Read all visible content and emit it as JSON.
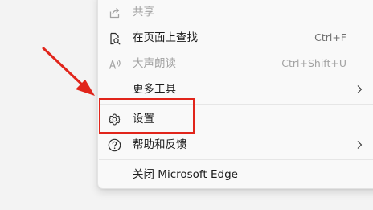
{
  "menu": {
    "items": [
      {
        "label": "共享",
        "shortcut": "",
        "icon": "share-icon",
        "disabled": true,
        "submenu": false
      },
      {
        "label": "在页面上查找",
        "shortcut": "Ctrl+F",
        "icon": "find-on-page-icon",
        "disabled": false,
        "submenu": false
      },
      {
        "label": "大声朗读",
        "shortcut": "Ctrl+Shift+U",
        "icon": "read-aloud-icon",
        "disabled": true,
        "submenu": false
      },
      {
        "label": "更多工具",
        "shortcut": "",
        "icon": "",
        "disabled": false,
        "submenu": true
      },
      {
        "label": "设置",
        "shortcut": "",
        "icon": "gear-icon",
        "disabled": false,
        "submenu": false
      },
      {
        "label": "帮助和反馈",
        "shortcut": "",
        "icon": "help-icon",
        "disabled": false,
        "submenu": true
      },
      {
        "label": "关闭 Microsoft Edge",
        "shortcut": "",
        "icon": "",
        "disabled": false,
        "submenu": false
      }
    ]
  },
  "annotation": {
    "highlight_color": "#e1251b",
    "arrow_color": "#e1251b"
  }
}
